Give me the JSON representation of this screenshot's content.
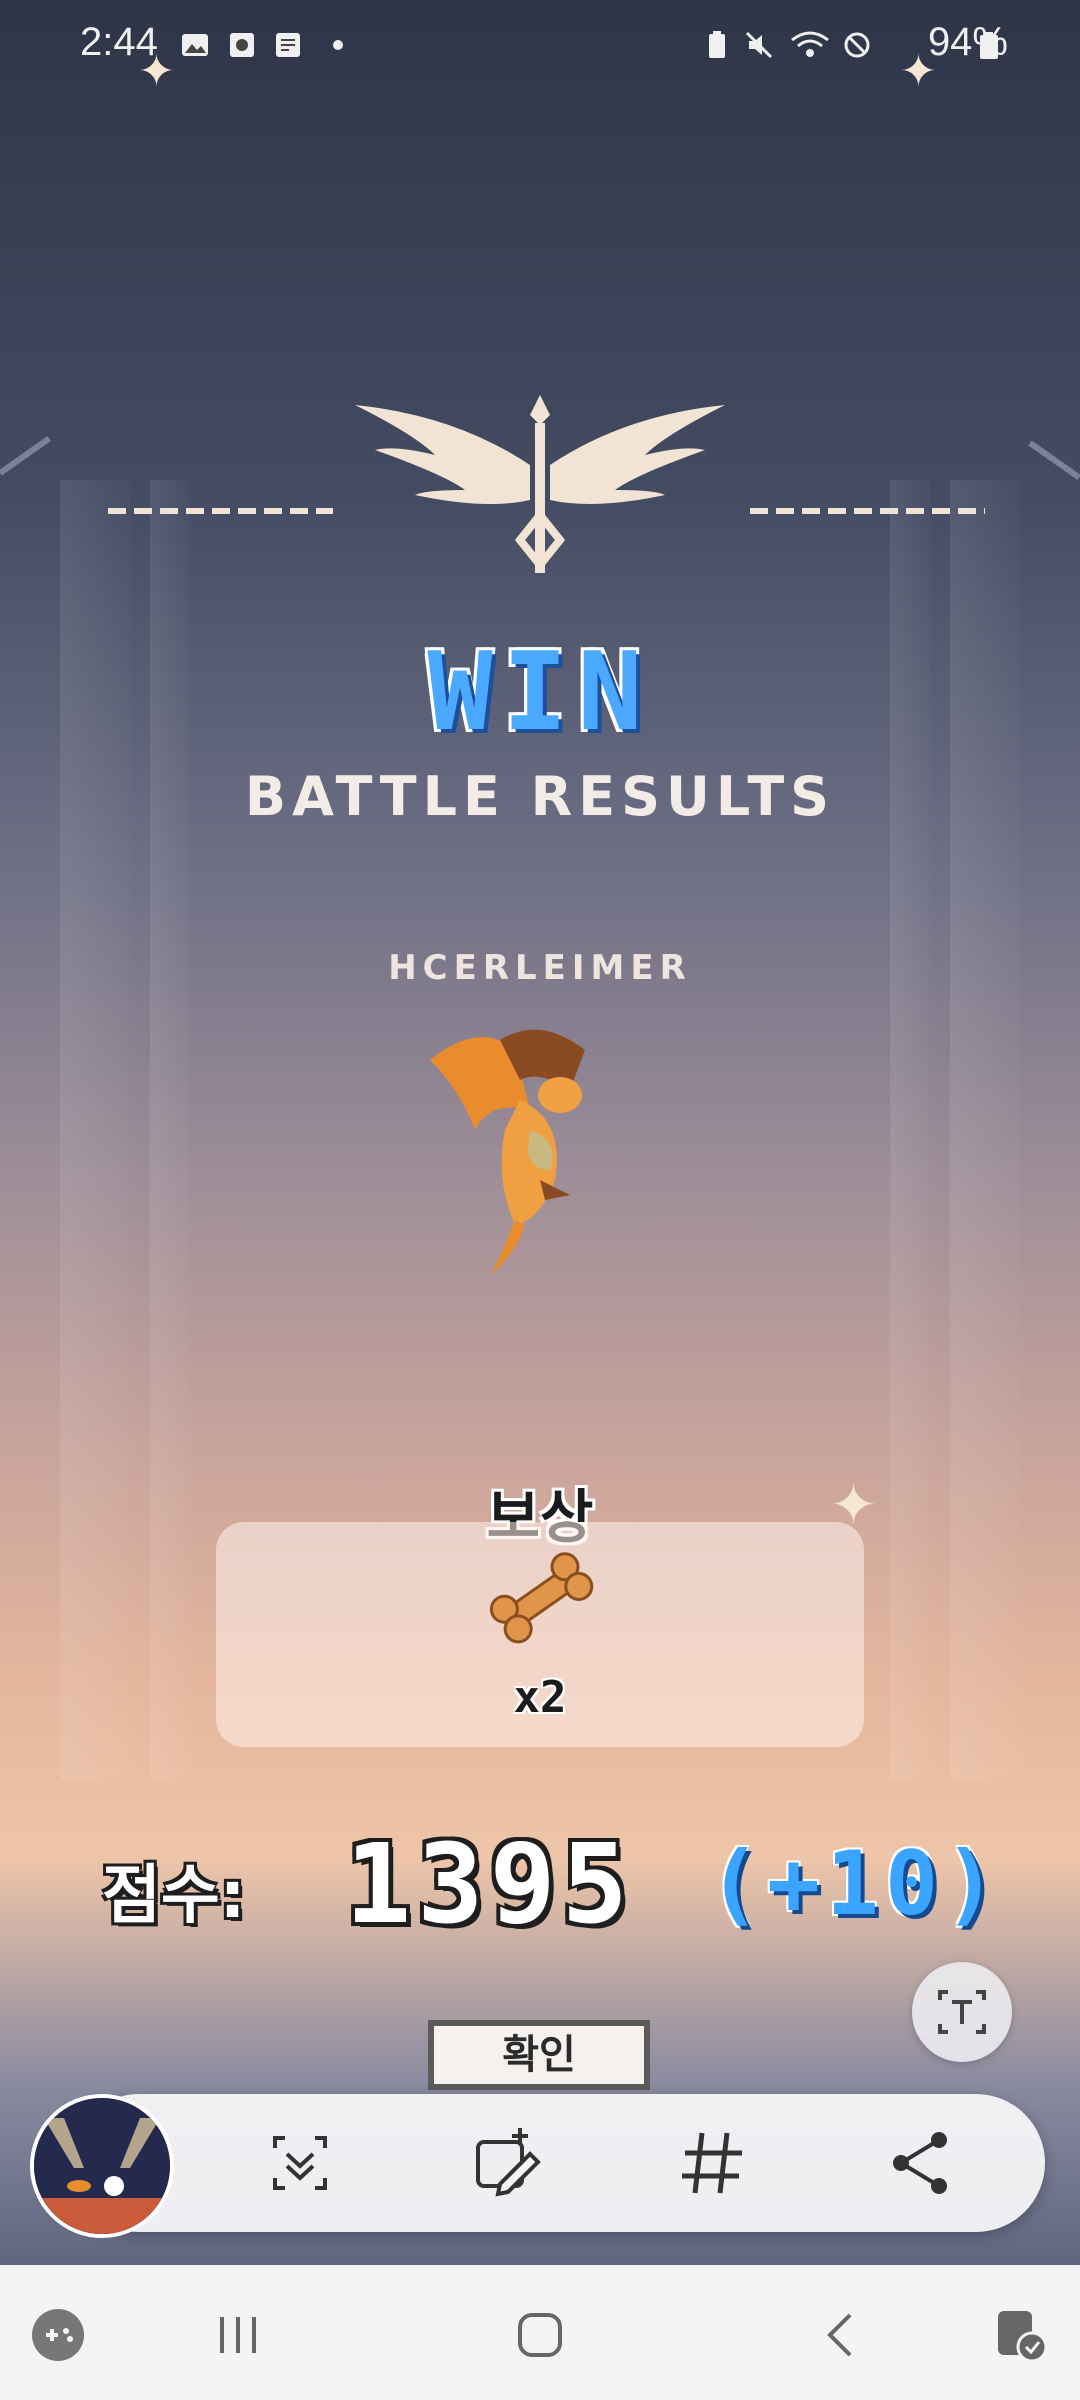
{
  "status_bar": {
    "time": "2:44",
    "battery_percent": "94%",
    "icons": [
      "gallery-icon",
      "video-icon",
      "screenshot-icon",
      "dot-icon",
      "battery-saver-icon",
      "mute-icon",
      "wifi-icon",
      "do-not-disturb-icon",
      "battery-icon"
    ]
  },
  "game": {
    "result_title": "WIN",
    "subtitle": "BATTLE RESULTS",
    "character_name": "HCERLEIMER",
    "reward_label": "보상",
    "reward_item_icon": "bone-icon",
    "reward_quantity": "x2",
    "score_label": "점수:",
    "score_value": "1395",
    "score_delta": "(+10)",
    "confirm_label": "확인",
    "colors": {
      "win": "#4aa8ff",
      "delta": "#3aa4ff"
    }
  },
  "screenshot_toolbar": {
    "buttons": [
      "scroll-capture-icon",
      "draw-icon",
      "hashtag-icon",
      "share-icon"
    ]
  },
  "overlay": {
    "text_extract_icon": "text-extract-icon"
  },
  "nav_bar": {
    "buttons": [
      "game-launcher-icon",
      "recent-apps-icon",
      "home-icon",
      "back-icon",
      "game-booster-icon"
    ]
  }
}
